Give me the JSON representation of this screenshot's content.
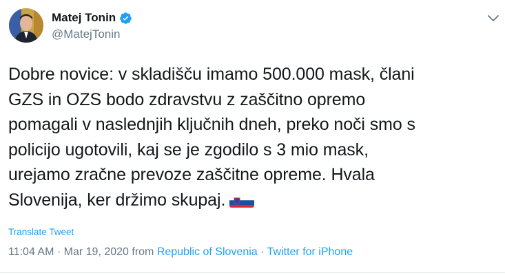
{
  "author": {
    "name": "Matej Tonin",
    "handle": "@MatejTonin",
    "verified": true
  },
  "tweet": {
    "lines": [
      "Dobre novice: v skladišču imamo 500.000 mask, člani",
      "GZS in OZS bodo zdravstvu z zaščitno opremo",
      "pomagali v naslednjih ključnih dneh, preko noči smo s",
      "policijo ugotovili, kaj se je zgodilo s 3 mio mask,",
      "urejamo zračne prevoze zaščitne opreme. Hvala",
      "Slovenija, ker držimo skupaj."
    ],
    "emoji": "flag-slovenia-icon",
    "translate_label": "Translate Tweet"
  },
  "meta": {
    "time": "11:04 AM",
    "sep1": " · ",
    "date": "Mar 19, 2020",
    "from": " from ",
    "location": "Republic of Slovenia",
    "sep2": " · ",
    "source": "Twitter for iPhone"
  },
  "colors": {
    "link": "#1da1f2",
    "secondary": "#657786",
    "text": "#14171a"
  }
}
